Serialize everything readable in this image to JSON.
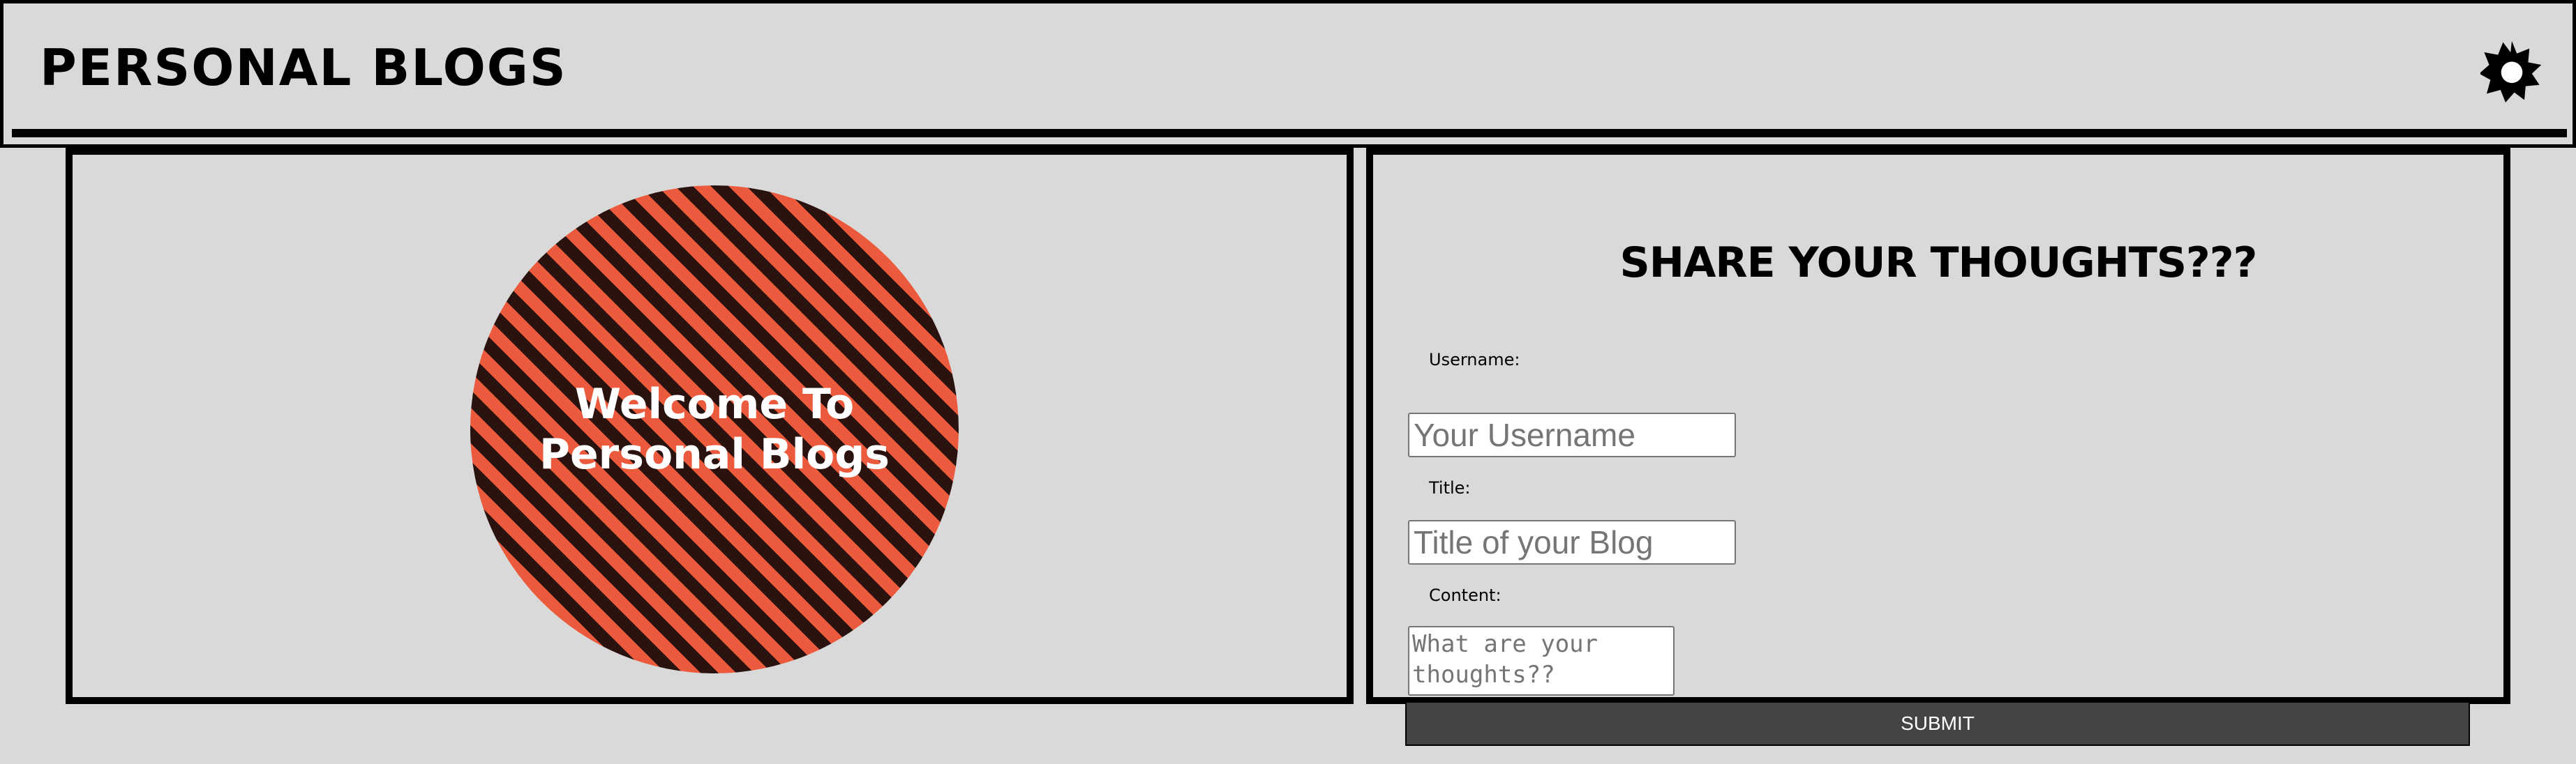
{
  "header": {
    "title": "PERSONAL BLOGS",
    "theme_icon": "sun-icon"
  },
  "hero": {
    "welcome_text": "Welcome To Personal Blogs",
    "circle_colors": [
      "#eb5a3c",
      "#2a120e"
    ]
  },
  "form": {
    "heading": "SHARE YOUR THOUGHTS???",
    "username_label": "Username:",
    "username_placeholder": "Your Username",
    "title_label": "Title:",
    "title_placeholder": "Title of your Blog",
    "content_label": "Content:",
    "content_placeholder": "What are your thoughts??",
    "submit_label": "SUBMIT"
  },
  "colors": {
    "background": "#d9d9d9",
    "border": "#000000",
    "button": "#444444"
  }
}
